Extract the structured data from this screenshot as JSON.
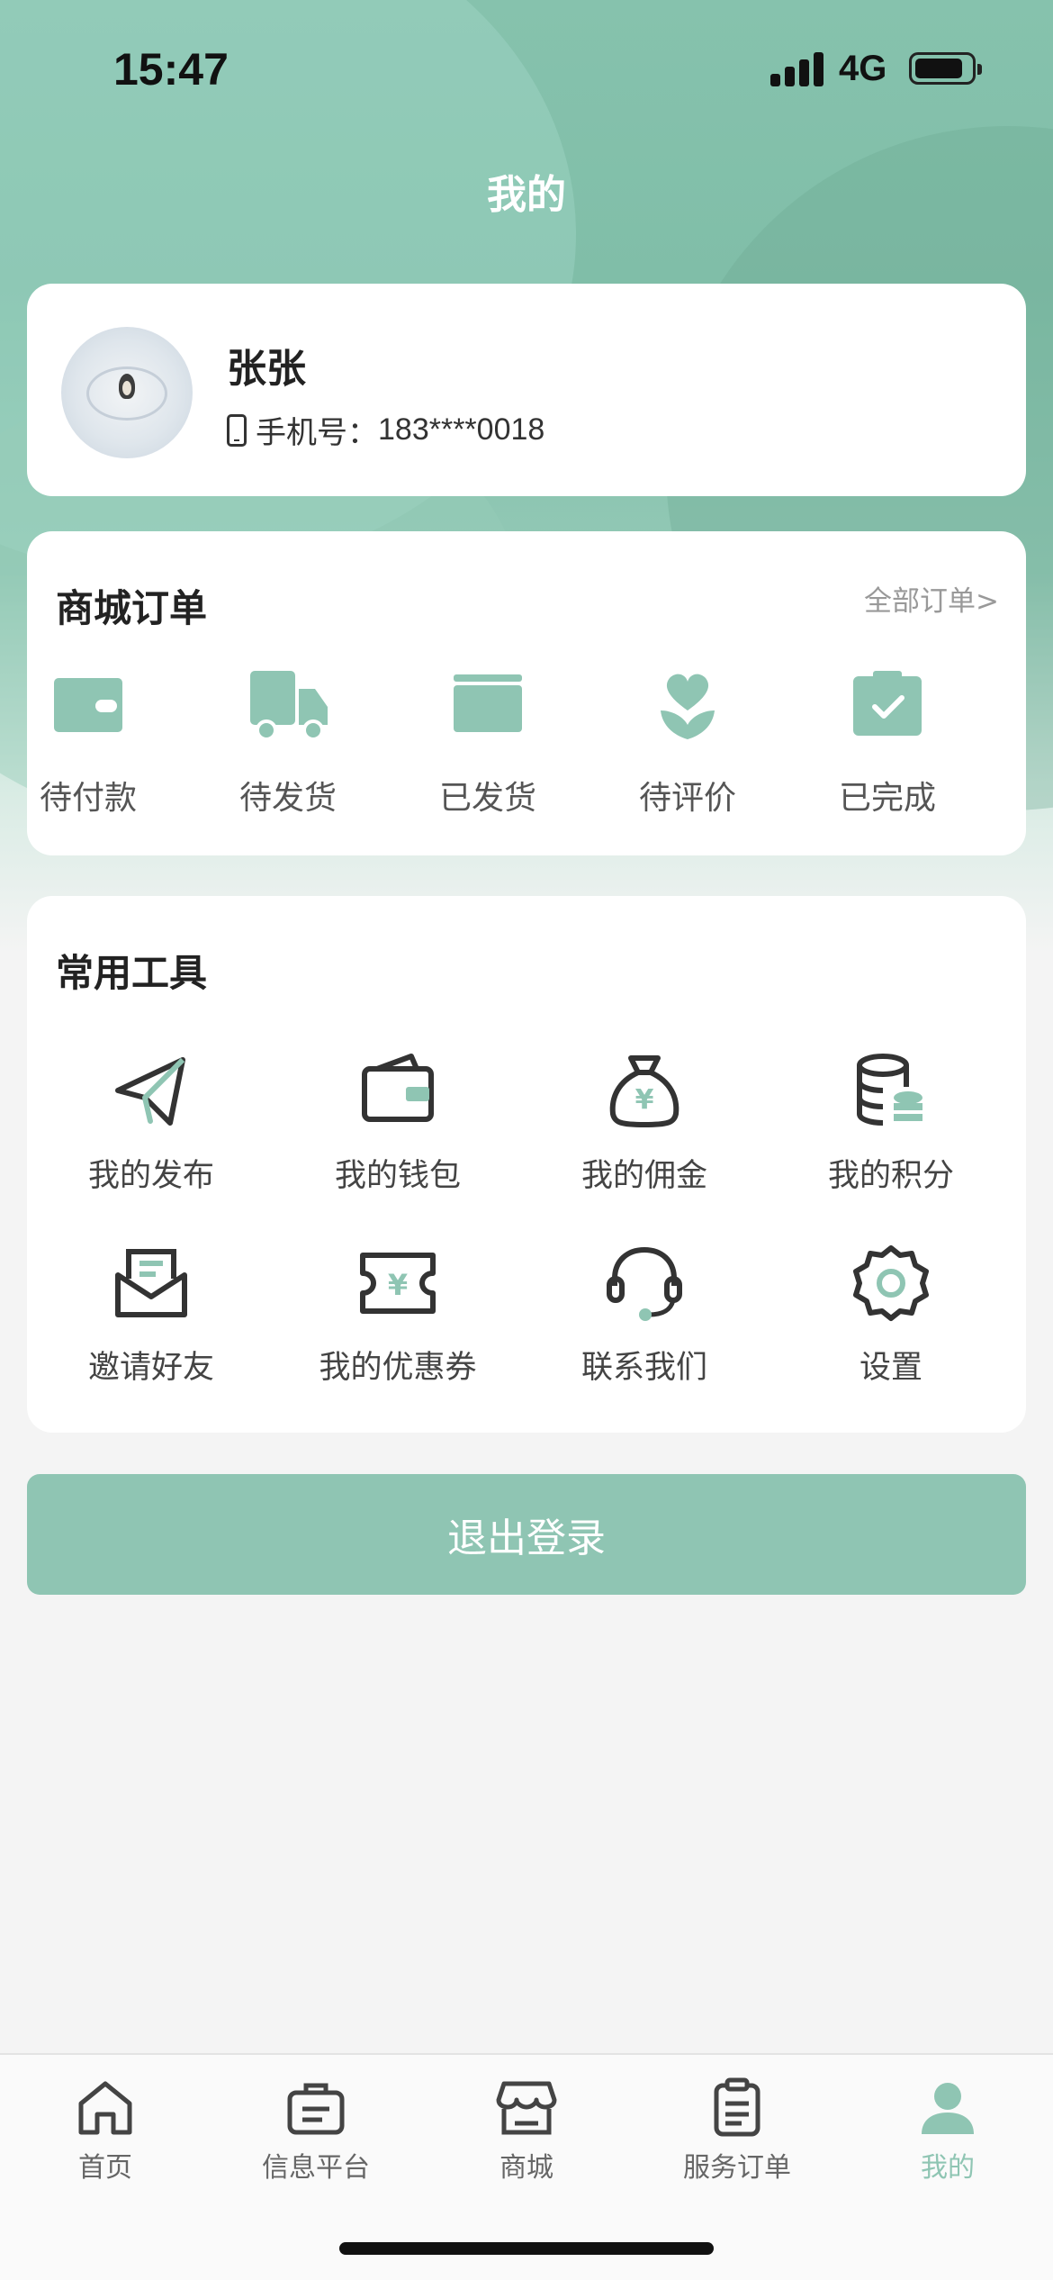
{
  "status_bar": {
    "time": "15:47",
    "network": "4G"
  },
  "header": {
    "title": "我的"
  },
  "profile": {
    "name": "张张",
    "phone_label": "手机号：",
    "phone": "183****0018"
  },
  "orders": {
    "title": "商城订单",
    "all_link": "全部订单>",
    "items": [
      {
        "label": "待付款",
        "icon": "wallet-icon"
      },
      {
        "label": "待发货",
        "icon": "truck-icon"
      },
      {
        "label": "已发货",
        "icon": "box-icon"
      },
      {
        "label": "待评价",
        "icon": "heart-flower-icon"
      },
      {
        "label": "已完成",
        "icon": "clipboard-check-icon"
      }
    ]
  },
  "tools": {
    "title": "常用工具",
    "items": [
      {
        "label": "我的发布",
        "icon": "paper-plane-icon"
      },
      {
        "label": "我的钱包",
        "icon": "wallet-icon"
      },
      {
        "label": "我的佣金",
        "icon": "money-bag-icon"
      },
      {
        "label": "我的积分",
        "icon": "coins-icon"
      },
      {
        "label": "邀请好友",
        "icon": "envelope-icon"
      },
      {
        "label": "我的优惠券",
        "icon": "coupon-icon"
      },
      {
        "label": "联系我们",
        "icon": "headset-icon"
      },
      {
        "label": "设置",
        "icon": "gear-icon"
      }
    ]
  },
  "logout": {
    "label": "退出登录"
  },
  "tabbar": {
    "active_index": 4,
    "items": [
      {
        "label": "首页",
        "icon": "home-icon"
      },
      {
        "label": "信息平台",
        "icon": "briefcase-icon"
      },
      {
        "label": "商城",
        "icon": "store-icon"
      },
      {
        "label": "服务订单",
        "icon": "clipboard-icon"
      },
      {
        "label": "我的",
        "icon": "user-icon"
      }
    ]
  },
  "colors": {
    "accent": "#8fc5b3",
    "header_bg": "#80bea8",
    "background": "#f4f4f4"
  }
}
